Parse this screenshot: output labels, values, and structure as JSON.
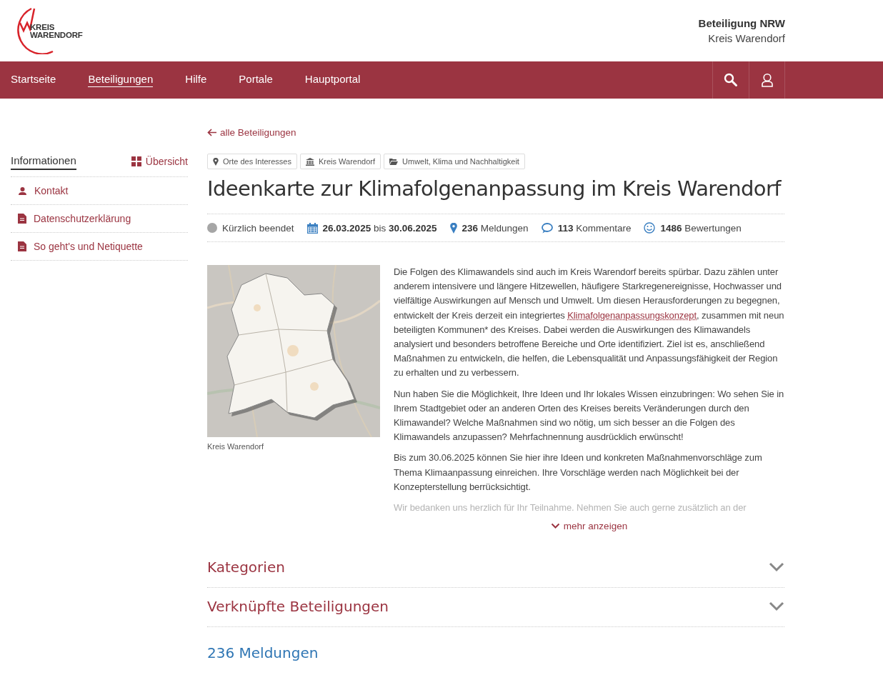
{
  "logo": {
    "line1": "KREIS",
    "line2": "WARENDORF"
  },
  "header": {
    "title": "Beteiligung NRW",
    "subtitle": "Kreis Warendorf"
  },
  "nav": {
    "items": [
      {
        "label": "Startseite",
        "selected": false
      },
      {
        "label": "Beteiligungen",
        "selected": true
      },
      {
        "label": "Hilfe",
        "selected": false
      },
      {
        "label": "Portale",
        "selected": false
      },
      {
        "label": "Hauptportal",
        "selected": false
      }
    ]
  },
  "sidebar": {
    "title": "Informationen",
    "overview": "Übersicht",
    "items": [
      {
        "label": "Kontakt",
        "kind": "person"
      },
      {
        "label": "Datenschutzerklärung",
        "kind": "document"
      },
      {
        "label": "So geht's und Netiquette",
        "kind": "document"
      }
    ]
  },
  "back_link": "alle Beteiligungen",
  "tags": [
    {
      "label": "Orte des Interesses",
      "kind": "pin"
    },
    {
      "label": "Kreis Warendorf",
      "kind": "institution"
    },
    {
      "label": "Umwelt, Klima und Nachhaltigkeit",
      "kind": "folder"
    }
  ],
  "title": "Ideenkarte zur Klimafolgenanpassung im Kreis Warendorf",
  "meta": {
    "status": "Kürzlich beendet",
    "ended": true,
    "date_from": "26.03.2025",
    "date_sep": "bis",
    "date_to": "30.06.2025",
    "reports_count": "236",
    "reports_label": "Meldungen",
    "comments_count": "113",
    "comments_label": "Kommentare",
    "ratings_count": "1486",
    "ratings_label": "Bewertungen"
  },
  "image": {
    "kind": "picture",
    "caption": "Kreis Warendorf"
  },
  "description": {
    "paragraphs": [
      {
        "before": "Die Folgen des Klimawandels sind auch im Kreis Warendorf bereits spürbar. Dazu zählen unter anderem intensivere und längere Hitzewellen, häufigere Starkregenereignisse, Hochwasser und vielfältige Auswirkungen auf Mensch und Umwelt. Um diesen Herausforderungen zu begegnen, entwickelt der Kreis derzeit ein integriertes ",
        "faded": false,
        "link": "Klimafolgenanpassungskonzept",
        "after": ", zusammen mit neun beteiligten Kommunen* des Kreises. Dabei werden die Auswirkungen des Klimawandels analysiert und besonders betroffene Bereiche und Orte identifiziert. Ziel ist es, anschließend Maßnahmen zu entwickeln, die helfen, die Lebensqualität und Anpassungsfähigkeit der Region zu erhalten und zu verbessern."
      },
      {
        "before": "Nun haben Sie die Möglichkeit, Ihre Ideen und Ihr lokales Wissen einzubringen: Wo sehen Sie in Ihrem Stadtgebiet oder an anderen Orten des Kreises bereits Veränderungen durch den Klimawandel? Welche Maßnahmen sind wo nötig, um sich besser an die Folgen des Klimawandels anzupassen? Mehrfachnennung ausdrücklich erwünscht!",
        "faded": false
      },
      {
        "before": "Bis zum 30.06.2025 können Sie hier ihre Ideen und konkreten Maßnahmenvorschläge zum Thema Klimaanpassung einreichen. Ihre Vorschläge werden nach Möglichkeit bei der Konzepterstellung berrücksichtigt.",
        "faded": false
      },
      {
        "before": "Wir bedanken uns herzlich für Ihr Teilnahme. Nehmen Sie auch gerne zusätzlich an der",
        "faded": true
      }
    ],
    "more": "mehr anzeigen"
  },
  "sections": [
    {
      "title": "Kategorien",
      "expanded": false
    },
    {
      "title": "Verknüpfte Beteiligungen",
      "expanded": false
    }
  ],
  "results_heading": "236 Meldungen"
}
